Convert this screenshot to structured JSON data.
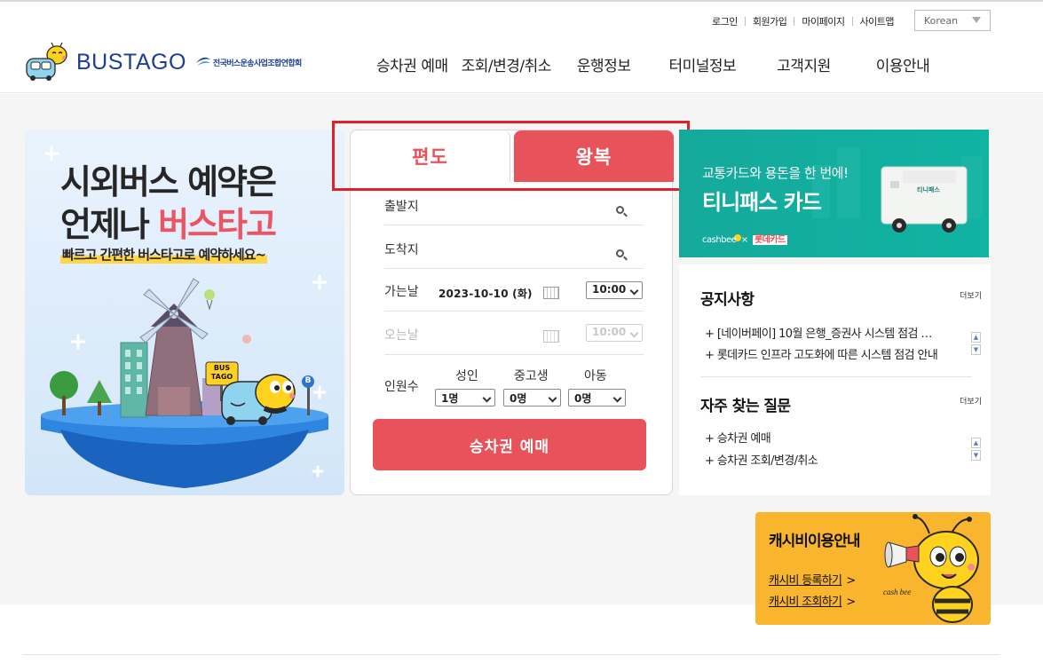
{
  "header": {
    "util_links": [
      "로그인",
      "회원가입",
      "마이페이지",
      "사이트맵"
    ],
    "language": "Korean",
    "logo_text": "BUSTAGO",
    "assoc_name": "전국버스운송사업조합연합회",
    "nav": [
      "승차권 예매",
      "조회/변경/취소",
      "운행정보",
      "터미널정보",
      "고객지원",
      "이용안내"
    ]
  },
  "banner": {
    "line1": "시외버스 예약은",
    "line2_a": "언제나 ",
    "line2_b": "버스타고",
    "sub": "빠르고 간편한 버스타고로 예약하세요~",
    "sign": "BUS TAGO",
    "stop_letter": "B"
  },
  "booking": {
    "tab_oneway": "편도",
    "tab_round": "왕복",
    "departure_label": "출발지",
    "arrival_label": "도착지",
    "go_date_label": "가는날",
    "go_date": "2023-10-10 (화)",
    "go_time": "10:00",
    "return_date_label": "오는날",
    "return_time": "10:00",
    "passenger_label": "인원수",
    "adult_label": "성인",
    "youth_label": "중고생",
    "child_label": "아동",
    "adult_count": "1명",
    "youth_count": "0명",
    "child_count": "0명",
    "submit": "승차권 예매"
  },
  "tpass": {
    "line1": "교통카드와 용돈을 한 번에!",
    "line2": "티니패스 카드",
    "brand1": "cashbee",
    "brand2": "롯데카드",
    "card_text": "티니패스"
  },
  "notice": {
    "title": "공지사항",
    "more": "더보기",
    "items": [
      "+ [네이버페이] 10월 은행_증권사 시스템 점검 …",
      "+ 롯데카드 인프라 고도화에 따른 시스템 점검 안내"
    ]
  },
  "faq": {
    "title": "자주 찾는 질문",
    "more": "더보기",
    "items": [
      "+ 승차권 예매",
      "+ 승차권 조회/변경/취소"
    ]
  },
  "cashbee": {
    "title": "캐시비이용안내",
    "link1": "캐시비 등록하기",
    "link2": "캐시비 조회하기",
    "brand": "cash bee"
  },
  "colors": {
    "accent_red": "#e8525a",
    "logo_blue": "#1c3f95",
    "tpass_teal": "#14a99b",
    "cashbee_yellow": "#f9b52e"
  }
}
